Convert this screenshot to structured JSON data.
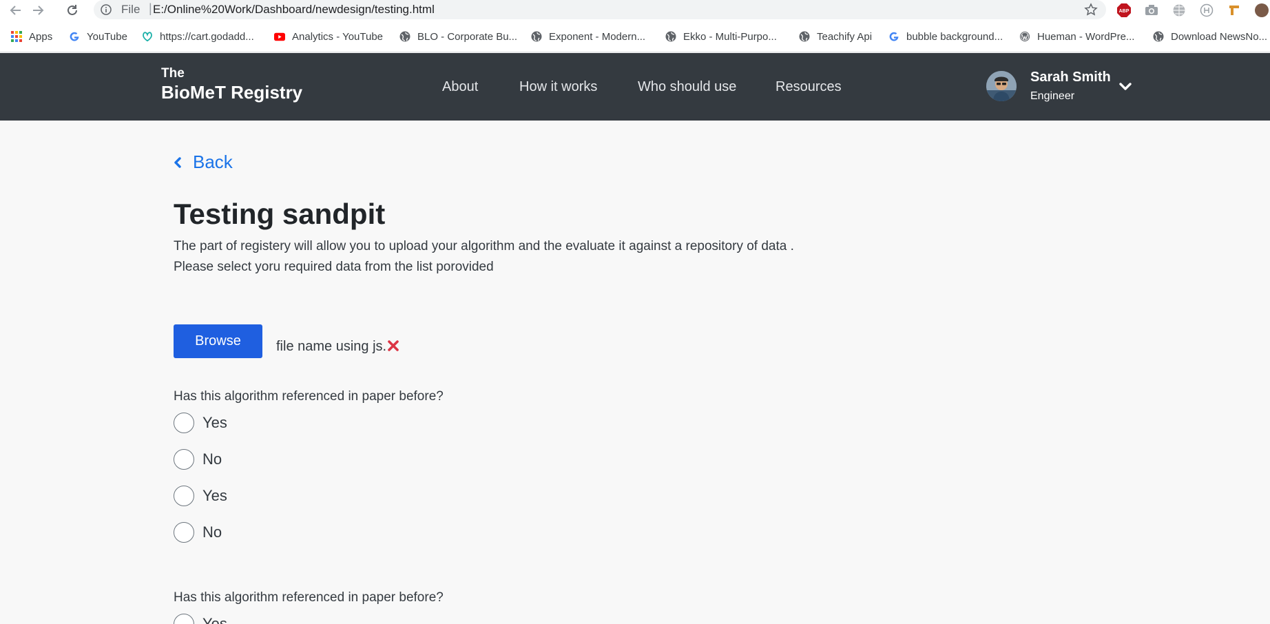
{
  "browser": {
    "omnibox_scheme": "File",
    "omnibox_separator": "|",
    "url": "E:/Online%20Work/Dashboard/newdesign/testing.html",
    "extension_abp_label": "ABP"
  },
  "bookmarks": [
    {
      "label": "Apps",
      "icon": "apps-grid-icon"
    },
    {
      "label": "YouTube",
      "icon": "google-icon"
    },
    {
      "label": "https://cart.godadd...",
      "icon": "godaddy-icon"
    },
    {
      "label": "Analytics - YouTube",
      "icon": "youtube-icon"
    },
    {
      "label": "BLO - Corporate Bu...",
      "icon": "globe-icon"
    },
    {
      "label": "Exponent - Modern...",
      "icon": "globe-icon"
    },
    {
      "label": "Ekko - Multi-Purpo...",
      "icon": "globe-icon"
    },
    {
      "label": "Teachify Api",
      "icon": "globe-icon"
    },
    {
      "label": "bubble background...",
      "icon": "google-icon"
    },
    {
      "label": "Hueman - WordPre...",
      "icon": "wordpress-icon"
    },
    {
      "label": "Download NewsNo...",
      "icon": "globe-icon"
    }
  ],
  "header": {
    "brand_the": "The",
    "brand_name": "BioMeT Registry",
    "nav": [
      "About",
      "How it works",
      "Who should use",
      "Resources"
    ],
    "user_name": "Sarah Smith",
    "user_role": "Engineer"
  },
  "content": {
    "back_label": "Back",
    "title": "Testing sandpit",
    "intro": "The part of registery will allow you to upload your algorithm and the evaluate it against a repository of data . Please select yoru required data from the list porovided",
    "browse_label": "Browse",
    "file_name": "file name using js.",
    "question1": "Has this algorithm referenced in paper before?",
    "options1": [
      "Yes",
      "No",
      "Yes",
      "No"
    ],
    "question2": "Has this algorithm referenced in paper before?",
    "options2": [
      "Yes"
    ]
  },
  "colors": {
    "header_bg": "#343a40",
    "link_blue": "#1a73e8",
    "button_blue": "#1f5fe0",
    "remove_red": "#dc3545",
    "page_bg": "#f8f8f8"
  }
}
